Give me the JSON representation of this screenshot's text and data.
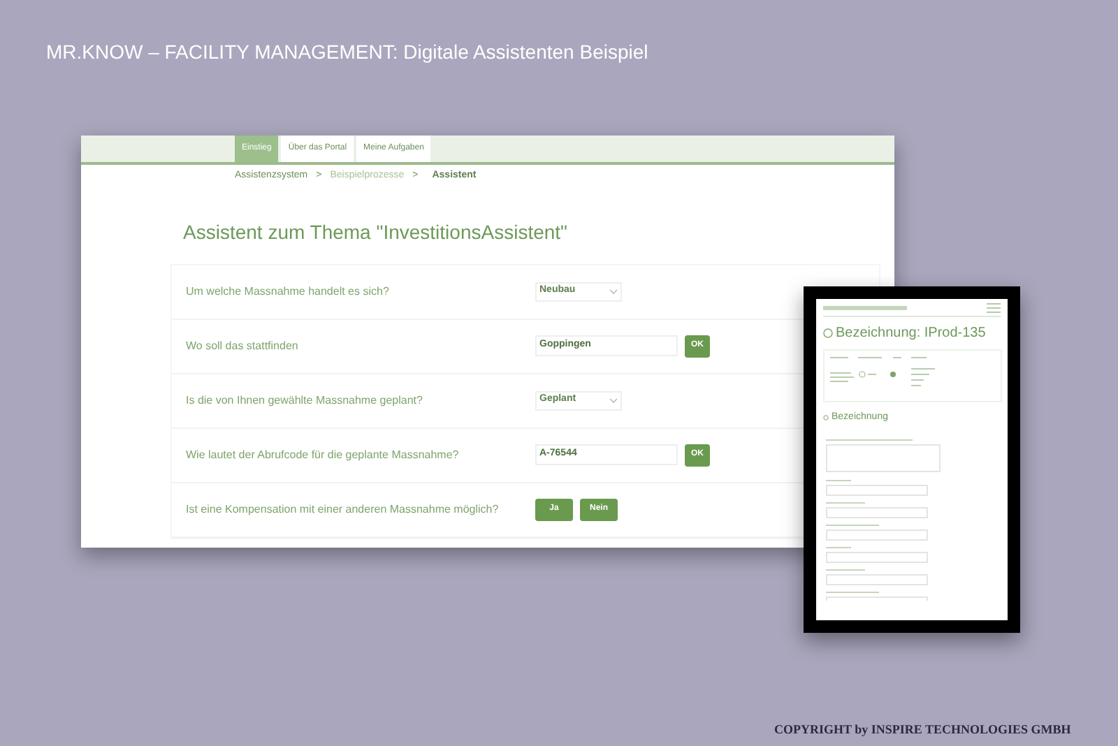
{
  "slide_title": "MR.KNOW – FACILITY MANAGEMENT: Digitale Assistenten Beispiel",
  "portal": {
    "tabs": [
      {
        "label": "Einstieg",
        "selected": true
      },
      {
        "label": "Über das Portal",
        "selected": false
      },
      {
        "label": "Meine Aufgaben",
        "selected": false
      }
    ],
    "breadcrumb": [
      {
        "label": "Assistenzsystem",
        "kind": "link"
      },
      {
        "label": ">",
        "kind": "separator"
      },
      {
        "label": "Beispielprozesse",
        "kind": "muted"
      },
      {
        "label": ">",
        "kind": "separator"
      },
      {
        "label": "Assistent",
        "kind": "current"
      }
    ],
    "heading": "Assistent zum Thema \"InvestitionsAssistent\"",
    "questions": [
      {
        "kind": "select",
        "label": "Um welche Massnahme handelt es sich?",
        "value": "Neubau"
      },
      {
        "kind": "input",
        "label": "Wo soll das stattfinden",
        "value": "Goppingen",
        "button": "OK"
      },
      {
        "kind": "select",
        "label": "Is die von Ihnen gewählte Massnahme geplant?",
        "value": "Geplant"
      },
      {
        "kind": "input",
        "label": "Wie lautet der Abrufcode für die geplante Massnahme?",
        "value": "A-76544",
        "button": "OK"
      },
      {
        "kind": "buttons",
        "label": "Ist eine Kompensation mit einer anderen Massnahme möglich?",
        "buttons": [
          "Ja",
          "Nein"
        ]
      }
    ]
  },
  "tablet": {
    "title": "Bezeichnung: IProd-135",
    "section": "Bezeichnung"
  },
  "copyright": "COPYRIGHT by INSPIRE TECHNOLOGIES GMBH"
}
